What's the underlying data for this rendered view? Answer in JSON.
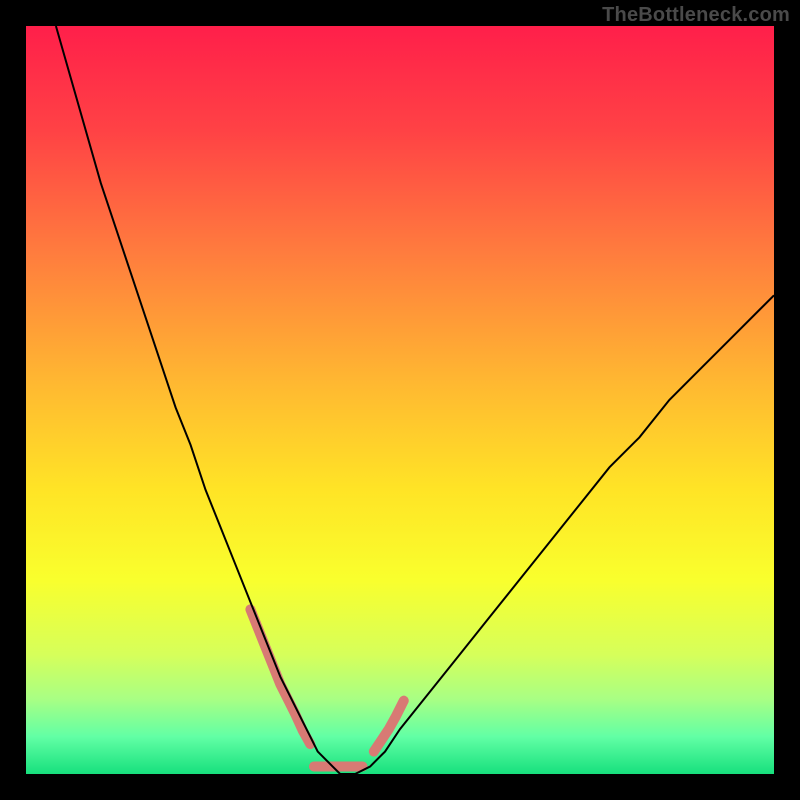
{
  "watermark": "TheBottleneck.com",
  "chart_data": {
    "type": "line",
    "title": "",
    "xlabel": "",
    "ylabel": "",
    "xlim": [
      0,
      100
    ],
    "ylim": [
      0,
      100
    ],
    "background_gradient": {
      "stops": [
        {
          "t": 0.0,
          "color": "#ff1f4a"
        },
        {
          "t": 0.14,
          "color": "#ff4245"
        },
        {
          "t": 0.3,
          "color": "#ff7b3e"
        },
        {
          "t": 0.48,
          "color": "#ffb931"
        },
        {
          "t": 0.62,
          "color": "#ffe426"
        },
        {
          "t": 0.74,
          "color": "#f9ff2d"
        },
        {
          "t": 0.84,
          "color": "#d6ff5a"
        },
        {
          "t": 0.9,
          "color": "#a8ff84"
        },
        {
          "t": 0.95,
          "color": "#62ffa5"
        },
        {
          "t": 1.0,
          "color": "#17e07d"
        }
      ]
    },
    "series": [
      {
        "name": "primary-curve",
        "color": "#000000",
        "width": 2,
        "x": [
          4,
          6,
          8,
          10,
          12,
          14,
          16,
          18,
          20,
          22,
          24,
          26,
          28,
          30,
          32,
          34,
          35,
          36,
          37,
          38,
          39,
          40,
          41,
          42,
          44,
          46,
          48,
          50,
          54,
          58,
          62,
          66,
          70,
          74,
          78,
          82,
          86,
          90,
          94,
          98,
          100
        ],
        "y": [
          100,
          93,
          86,
          79,
          73,
          67,
          61,
          55,
          49,
          44,
          38,
          33,
          28,
          23,
          18,
          13,
          11,
          9,
          7,
          5,
          3,
          2,
          1,
          0,
          0,
          1,
          3,
          6,
          11,
          16,
          21,
          26,
          31,
          36,
          41,
          45,
          50,
          54,
          58,
          62,
          64
        ]
      },
      {
        "name": "marker-overlay",
        "color": "#d87a74",
        "width": 10,
        "linecap": "round",
        "segments": [
          {
            "x": [
              30,
              31,
              32,
              33,
              34,
              35,
              36,
              37,
              38
            ],
            "y": [
              22,
              19.5,
              17,
              14.5,
              12,
              10,
              8,
              5.8,
              4
            ]
          },
          {
            "x": [
              38.5,
              40,
              42,
              44,
              45
            ],
            "y": [
              1,
              1,
              1,
              1,
              1
            ]
          },
          {
            "x": [
              46.5,
              47.5,
              48.5,
              49.5,
              50.5
            ],
            "y": [
              3,
              4.5,
              6,
              7.8,
              9.8
            ]
          }
        ]
      }
    ]
  }
}
